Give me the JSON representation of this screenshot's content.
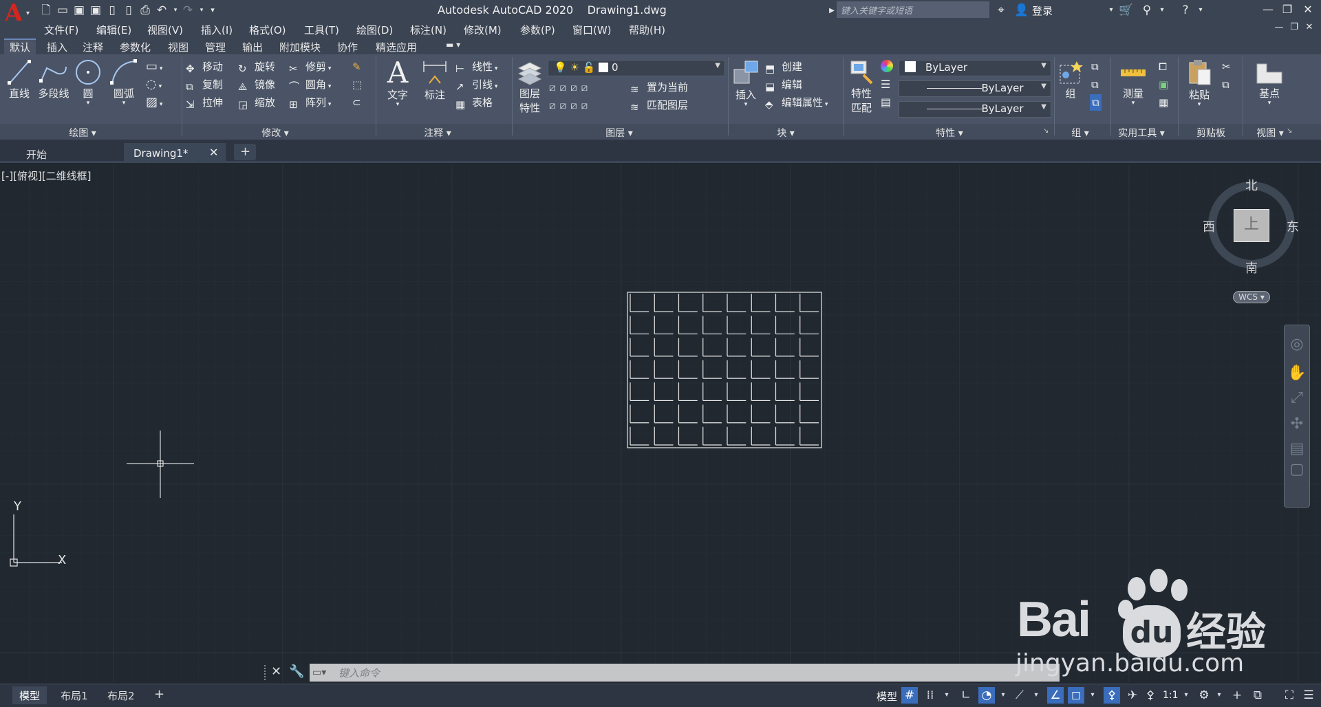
{
  "app": {
    "logo_letter": "A",
    "title": "Autodesk AutoCAD 2020    Drawing1.dwg",
    "search_placeholder": "键入关键字或短语",
    "login_label": "登录"
  },
  "menu": [
    "文件(F)",
    "编辑(E)",
    "视图(V)",
    "插入(I)",
    "格式(O)",
    "工具(T)",
    "绘图(D)",
    "标注(N)",
    "修改(M)",
    "参数(P)",
    "窗口(W)",
    "帮助(H)"
  ],
  "ribbon_tabs": [
    "默认",
    "插入",
    "注释",
    "参数化",
    "视图",
    "管理",
    "输出",
    "附加模块",
    "协作",
    "精选应用"
  ],
  "panels": {
    "draw": {
      "title": "绘图",
      "line": "直线",
      "polyline": "多段线",
      "circle": "圆",
      "arc": "圆弧"
    },
    "modify": {
      "title": "修改",
      "move": "移动",
      "rotate": "旋转",
      "trim": "修剪",
      "copy": "复制",
      "mirror": "镜像",
      "fillet": "圆角",
      "stretch": "拉伸",
      "scale": "缩放",
      "array": "阵列"
    },
    "annotation": {
      "title": "注释",
      "text": "文字",
      "dimension": "标注",
      "linear": "线性",
      "leader": "引线",
      "table": "表格"
    },
    "layers": {
      "title": "图层",
      "layer_props": "图层\n特性",
      "layer_props_1": "图层",
      "layer_props_2": "特性",
      "current_layer": "0",
      "set_current": "置为当前",
      "match_layer": "匹配图层"
    },
    "block": {
      "title": "块",
      "insert": "插入",
      "create": "创建",
      "edit": "编辑",
      "edit_attr": "编辑属性"
    },
    "properties": {
      "title": "特性",
      "match_1": "特性",
      "match_2": "匹配",
      "color": "ByLayer",
      "linetype": "ByLayer",
      "lineweight": "ByLayer"
    },
    "groups": {
      "title": "组",
      "group": "组"
    },
    "utilities": {
      "title": "实用工具",
      "measure": "测量"
    },
    "clipboard": {
      "title": "剪贴板",
      "paste": "粘贴"
    },
    "view": {
      "title": "视图",
      "base": "基点"
    }
  },
  "doc_tabs": [
    "开始",
    "Drawing1*"
  ],
  "canvas": {
    "view_label": "[-][俯视][二维线框]",
    "viewcube": {
      "north": "北",
      "south": "南",
      "east": "东",
      "west": "西",
      "face": "上"
    },
    "wcs": "WCS",
    "ucs_x": "X",
    "ucs_y": "Y"
  },
  "command": {
    "placeholder": "键入命令"
  },
  "status": {
    "layout_tabs": [
      "模型",
      "布局1",
      "布局2"
    ],
    "model_label": "模型",
    "scale": "1:1"
  },
  "watermark": {
    "brand": "Bai",
    "brand_du": "du",
    "jingyan": "经验",
    "url": "jingyan.baidu.com"
  },
  "colors": {
    "accent": "#3a6dbc",
    "canvas_bg": "#212830",
    "ribbon_bg": "#4a5466",
    "autocad_red": "#d4261f"
  }
}
